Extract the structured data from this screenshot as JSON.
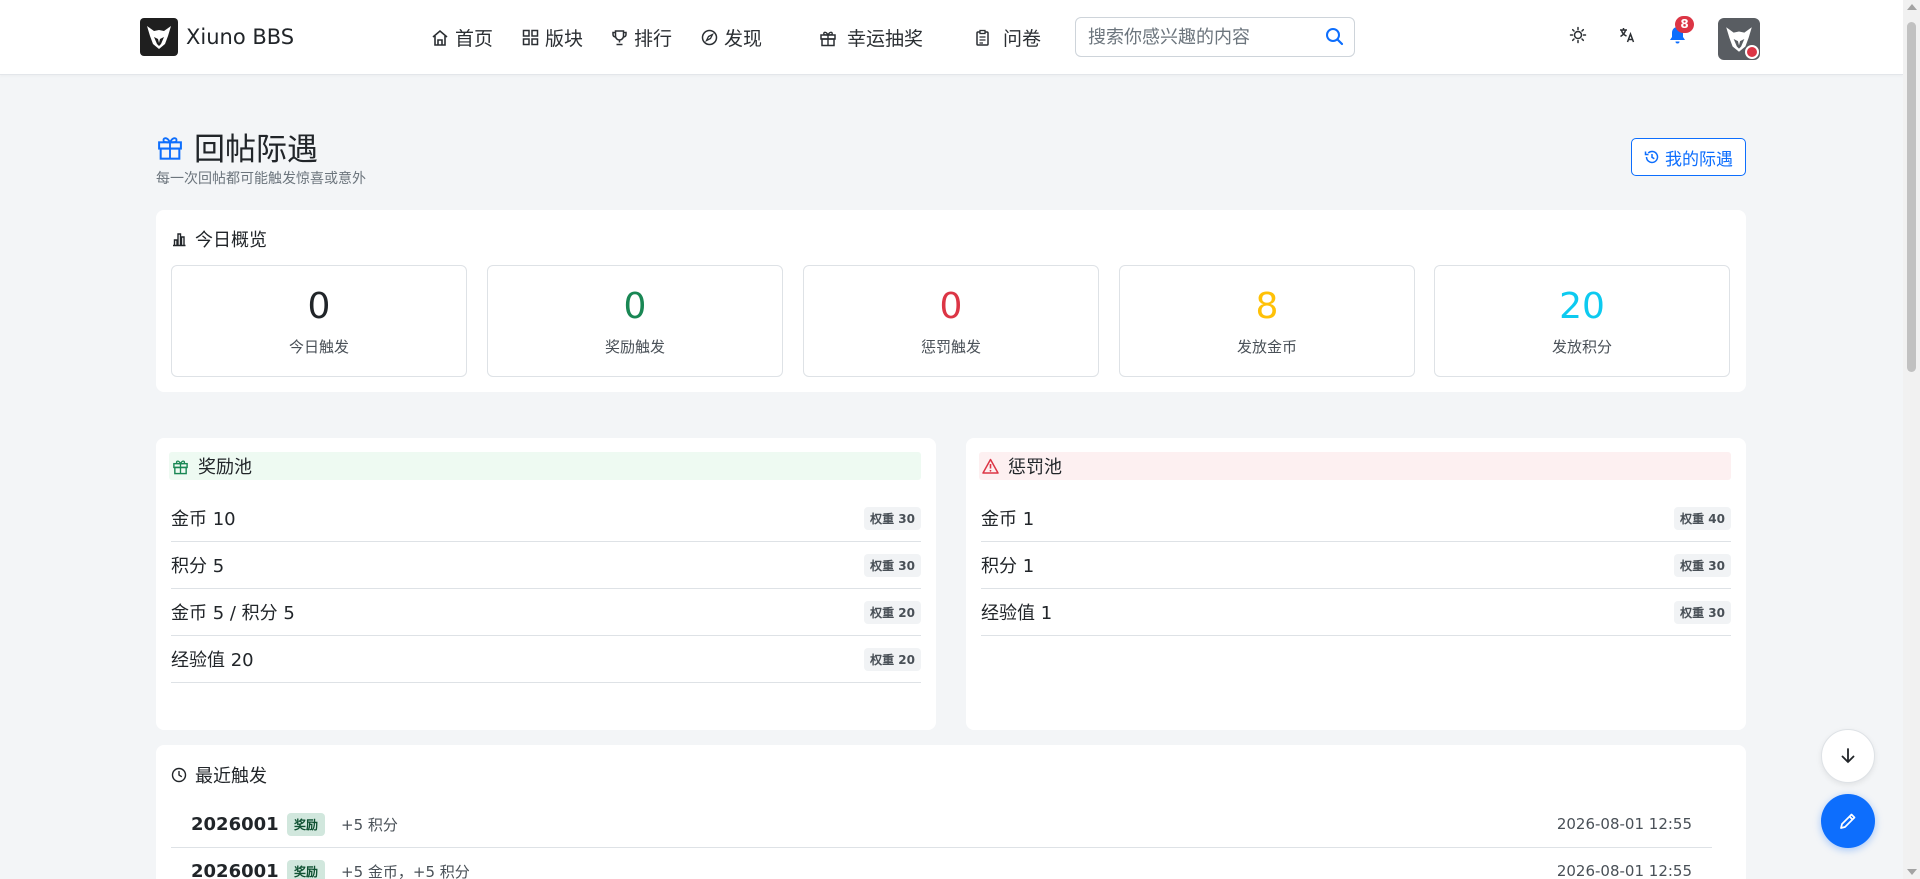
{
  "brand": {
    "name": "Xiuno BBS"
  },
  "nav": [
    {
      "label": "首页",
      "icon": "home-icon"
    },
    {
      "label": "版块",
      "icon": "grid-icon"
    },
    {
      "label": "排行",
      "icon": "trophy-icon"
    },
    {
      "label": "发现",
      "icon": "compass-icon"
    },
    {
      "label": "幸运抽奖",
      "icon": "gift-icon"
    },
    {
      "label": "问卷",
      "icon": "clipboard-icon"
    }
  ],
  "search": {
    "placeholder": "搜索你感兴趣的内容"
  },
  "header": {
    "notification_count": "8"
  },
  "page": {
    "title": "回帖际遇",
    "subtitle": "每一次回帖都可能触发惊喜或意外",
    "my_button": "我的际遇"
  },
  "overview": {
    "title": "今日概览",
    "stats": [
      {
        "value": "0",
        "label": "今日触发",
        "color": "#212529"
      },
      {
        "value": "0",
        "label": "奖励触发",
        "color": "#198754"
      },
      {
        "value": "0",
        "label": "惩罚触发",
        "color": "#dc3545"
      },
      {
        "value": "8",
        "label": "发放金币",
        "color": "#ffc107"
      },
      {
        "value": "20",
        "label": "发放积分",
        "color": "#0dcaf0"
      }
    ]
  },
  "reward_pool": {
    "title": "奖励池",
    "items": [
      {
        "name": "金币 10",
        "weight": "权重 30"
      },
      {
        "name": "积分 5",
        "weight": "权重 30"
      },
      {
        "name": "金币 5 / 积分 5",
        "weight": "权重 20"
      },
      {
        "name": "经验值 20",
        "weight": "权重 20"
      }
    ]
  },
  "penalty_pool": {
    "title": "惩罚池",
    "items": [
      {
        "name": "金币 1",
        "weight": "权重 40"
      },
      {
        "name": "积分 1",
        "weight": "权重 30"
      },
      {
        "name": "经验值 1",
        "weight": "权重 30"
      }
    ]
  },
  "recent": {
    "title": "最近触发",
    "rows": [
      {
        "id": "2026001",
        "type": "奖励",
        "desc": "+5 积分",
        "time": "2026-08-01 12:55"
      },
      {
        "id": "2026001",
        "type": "奖励",
        "desc": "+5 金币，+5 积分",
        "time": "2026-08-01 12:55"
      }
    ]
  },
  "colors": {
    "primary": "#0d6efd",
    "success": "#198754",
    "danger": "#dc3545",
    "warning": "#ffc107",
    "info": "#0dcaf0"
  }
}
